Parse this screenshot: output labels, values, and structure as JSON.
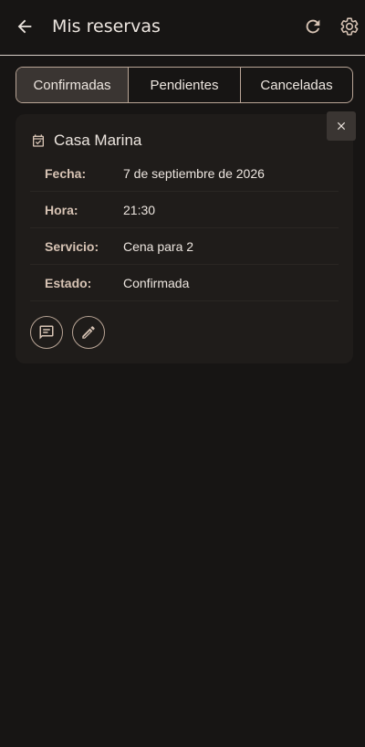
{
  "appbar": {
    "title": "Mis reservas",
    "back_icon": "arrow-left-icon",
    "refresh_icon": "refresh-icon",
    "settings_icon": "gear-icon"
  },
  "tabs": [
    {
      "label": "Confirmadas",
      "active": true
    },
    {
      "label": "Pendientes",
      "active": false
    },
    {
      "label": "Canceladas",
      "active": false
    }
  ],
  "reservation": {
    "name": "Casa Marina",
    "icon": "calendar-check-icon",
    "fields": [
      {
        "label": "Fecha:",
        "value": "7 de septiembre de 2026"
      },
      {
        "label": "Hora:",
        "value": "21:30"
      },
      {
        "label": "Servicio:",
        "value": "Cena para 2"
      },
      {
        "label": "Estado:",
        "value": "Confirmada"
      }
    ],
    "actions": [
      "message-icon",
      "pencil-icon"
    ]
  },
  "colors": {
    "background": "#171514",
    "card": "#1f1c1a",
    "accent": "#d7c3b4",
    "outline": "#b9a596",
    "active_tab": "#3a3532"
  }
}
